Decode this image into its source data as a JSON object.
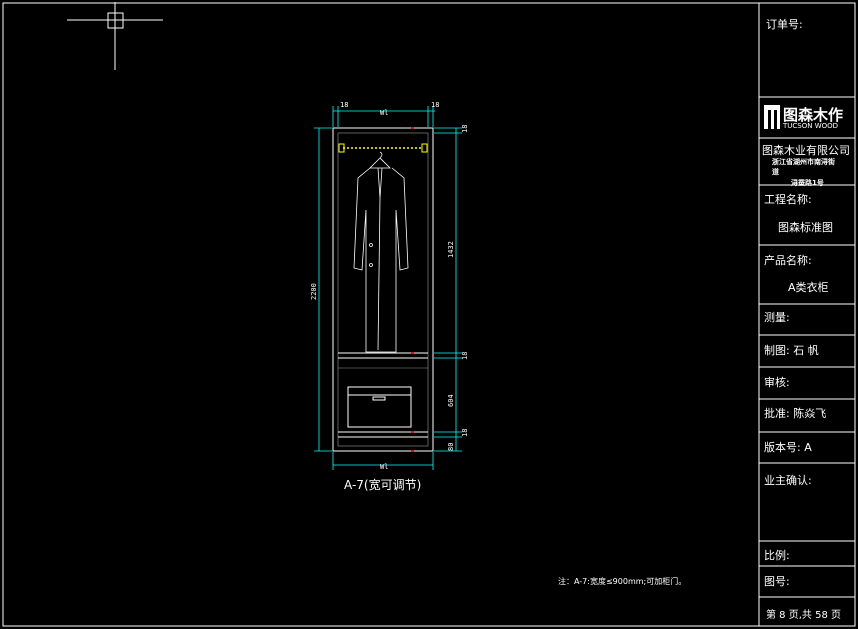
{
  "drawing": {
    "caption": "A-7(宽可调节)",
    "note": "注：A-7:宽度≤900mm;可加柜门。",
    "dimensions": {
      "top_left": "18",
      "top_middle": "Wl",
      "top_right": "18",
      "bottom_width": "Wl",
      "total_height": "2200",
      "upper_height": "1432",
      "shelf_1": "18",
      "drawer_height": "604",
      "shelf_2": "18",
      "top_board": "18",
      "plinth": "80"
    }
  },
  "title_block": {
    "order_no_label": "订单号:",
    "logo_name": "图森木作",
    "logo_sub": "TUCSON WOOD",
    "company": "图森木业有限公司",
    "address_1": "浙江省湖州市南浔街",
    "address_2": "道",
    "address_3": "浔蚕路1号",
    "project_label": "工程名称:",
    "project_value": "图森标准图",
    "product_label": "产品名称:",
    "product_value": "A类衣柜",
    "measure_label": "测量:",
    "drafter_label": "制图: 石  帆",
    "review_label": "审核:",
    "approve_label": "批准: 陈焱飞",
    "version_label": "版本号: A",
    "owner_label": "业主确认:",
    "scale_label": "比例:",
    "drawing_no_label": "图号:",
    "page_label": "第 8 页,共 58 页"
  },
  "colors": {
    "frame": "#ffffff",
    "cyan": "#00ffff",
    "yellow": "#ffff00",
    "red": "#ff0000",
    "grey": "#999999"
  }
}
